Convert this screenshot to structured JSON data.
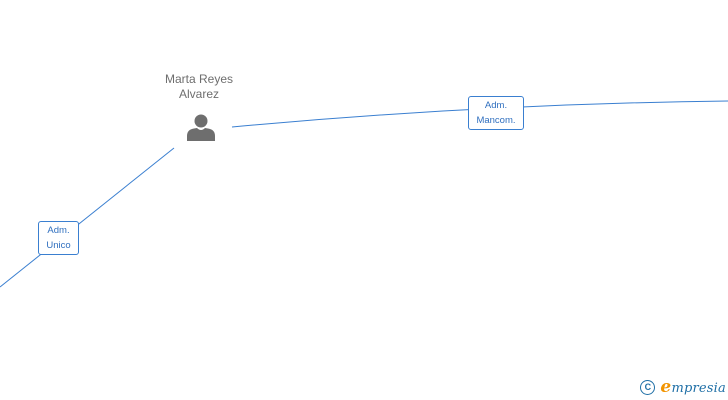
{
  "person": {
    "name_line1": "Marta Reyes",
    "name_line2": "Alvarez",
    "icon": "person-icon"
  },
  "roles": {
    "mancom": {
      "line1": "Adm.",
      "line2": "Mancom."
    },
    "unico": {
      "line1": "Adm.",
      "line2": "Unico"
    }
  },
  "brand": {
    "copyright_symbol": "C",
    "initial": "e",
    "rest": "mpresia"
  },
  "colors": {
    "edge": "#3a7fd0",
    "person_icon": "#6e6e6e",
    "name_text": "#6e6e6e",
    "role_text": "#2f6fbf",
    "brand_blue": "#1f6fa6",
    "brand_orange": "#f29400"
  }
}
